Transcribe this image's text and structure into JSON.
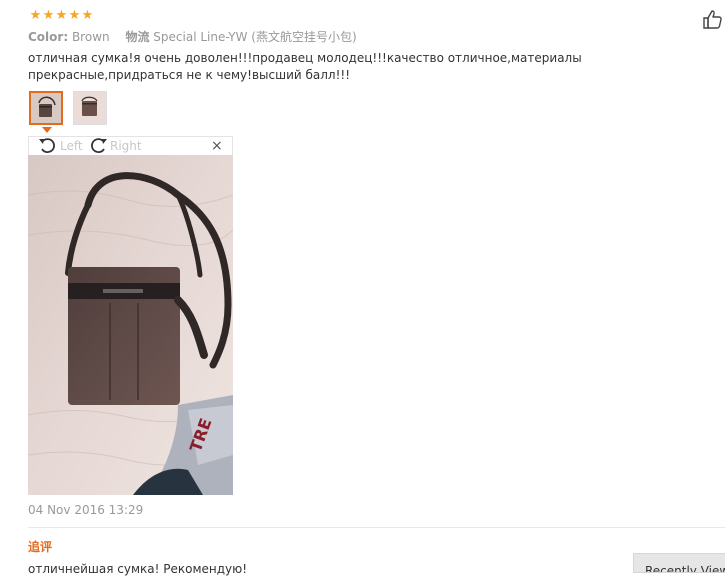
{
  "review": {
    "rating_stars": [
      "★",
      "★",
      "★",
      "★",
      "★"
    ],
    "color_label": "Color:",
    "color_value": "Brown",
    "shipping_label": "物流",
    "shipping_value": "Special Line-YW (燕文航空挂号小包)",
    "text": "отличная сумка!я очень доволен!!!продавец молодец!!!качество отличное,материалы прекрасные,придраться не к чему!высший балл!!!",
    "date": "04 Nov 2016 13:29"
  },
  "viewer": {
    "rotate_left_label": "Left",
    "rotate_right_label": "Right",
    "close_glyph": "×",
    "active_thumbnail": 1
  },
  "followup": {
    "label": "追评",
    "text": "отличнейшая сумка! Рекомендую!"
  },
  "recently_viewed": {
    "label": "Recently Viewed"
  },
  "colors": {
    "accent": "#e56a1c",
    "star": "#f5a623",
    "muted": "#999999"
  }
}
